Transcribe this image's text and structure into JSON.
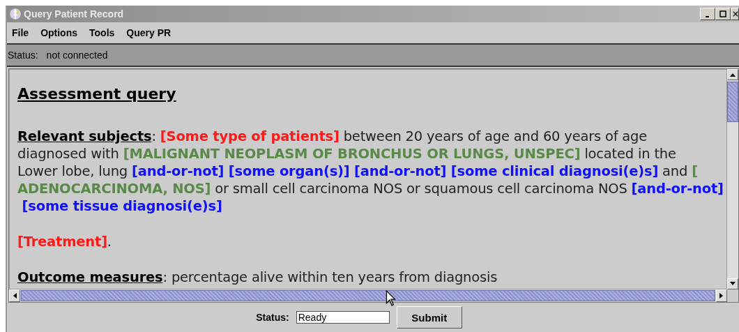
{
  "window": {
    "title": "Query Patient Record"
  },
  "menu": [
    "File",
    "Options",
    "Tools",
    "Query PR"
  ],
  "top_status": {
    "label": "Status:",
    "value": "not connected"
  },
  "document": {
    "heading": "Assessment query",
    "paragraphs": [
      {
        "lines": [
          [
            {
              "kind": "term",
              "text": "Relevant subjects"
            },
            {
              "kind": "plain",
              "text": ": "
            },
            {
              "kind": "red",
              "text": "[Some type of patients]"
            },
            {
              "kind": "plain",
              "text": " between 20 years of age and 60 years of age"
            }
          ],
          [
            {
              "kind": "plain",
              "text": "diagnosed with "
            },
            {
              "kind": "green",
              "text": "[MALIGNANT NEOPLASM OF BRONCHUS OR LUNGS, UNSPEC]"
            },
            {
              "kind": "plain",
              "text": " located in the"
            }
          ],
          [
            {
              "kind": "plain",
              "text": "Lower lobe, lung "
            },
            {
              "kind": "blue",
              "text": "[and-or-not] [some organ(s)] [and-or-not] [some clinical diagnosi(e)s]"
            },
            {
              "kind": "plain",
              "text": " and "
            },
            {
              "kind": "green",
              "text": "["
            }
          ],
          [
            {
              "kind": "green",
              "text": "ADENOCARCINOMA, NOS]"
            },
            {
              "kind": "plain",
              "text": " or small cell carcinoma NOS or squamous cell carcinoma NOS "
            },
            {
              "kind": "blue",
              "text": "[and-or-not]"
            }
          ],
          [
            {
              "kind": "blue",
              "text": " [some tissue diagnosi(e)s]"
            }
          ]
        ]
      },
      {
        "lines": [
          [
            {
              "kind": "red",
              "text": "[Treatment]"
            },
            {
              "kind": "plain",
              "text": "."
            }
          ]
        ]
      },
      {
        "lines": [
          [
            {
              "kind": "term",
              "text": "Outcome measures"
            },
            {
              "kind": "plain",
              "text": ": percentage alive within ten years from diagnosis"
            }
          ]
        ]
      }
    ]
  },
  "bottom": {
    "label": "Status:",
    "value": "Ready",
    "submit": "Submit"
  }
}
